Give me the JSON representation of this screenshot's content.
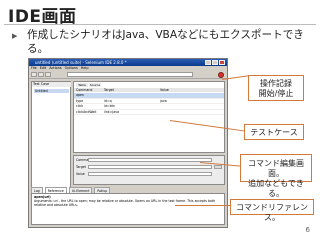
{
  "slide": {
    "title": "IDE画面",
    "bullet_marker": "▶",
    "bullet_text": "作成したシナリオはJava、VBAなどにもエクスポートできる。",
    "page_number": "6"
  },
  "callouts": {
    "record": "操作記録\n開始/停止",
    "testcase": "テストケース",
    "editor": "コマンド編集画面。\n追加などもできる。",
    "reference": "コマンドリファレンス。"
  },
  "app": {
    "titlebar_text": "untitled (untitled suite) - Selenium IDE 2.8.0 *",
    "menu": [
      "File",
      "Edit",
      "Actions",
      "Options",
      "Help"
    ],
    "testcase_header": "Test Case",
    "testcase_item": "Untitled",
    "table_tabs": [
      "Table",
      "Source"
    ],
    "columns": [
      "Command",
      "Target",
      "Value"
    ],
    "rows": [
      {
        "command": "open",
        "target": "",
        "value": ""
      },
      {
        "command": "type",
        "target": "id=q",
        "value": "java"
      },
      {
        "command": "click",
        "target": "id=btn",
        "value": ""
      },
      {
        "command": "clickAndWait",
        "target": "link=Java",
        "value": ""
      }
    ],
    "editor_labels": [
      "Command",
      "Target",
      "Value"
    ],
    "editor_values": [
      "open",
      "",
      ""
    ],
    "ref_tabs": [
      "Log",
      "Reference",
      "UI-Element",
      "Rollup"
    ],
    "ref_title": "open(url)",
    "ref_text": "Arguments: url - the URL to open; may be relative or absolute. Opens an URL in the test frame. This accepts both relative and absolute URLs."
  }
}
